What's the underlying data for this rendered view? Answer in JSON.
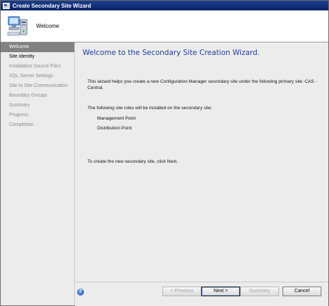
{
  "window": {
    "title": "Create Secondary Site Wizard"
  },
  "header": {
    "title": "Welcome"
  },
  "sidebar": {
    "items": [
      {
        "label": "Welcome"
      },
      {
        "label": "Site Identity"
      },
      {
        "label": "Installation Source Files"
      },
      {
        "label": "SQL Server Settings"
      },
      {
        "label": "Site to Site Communication"
      },
      {
        "label": "Boundary Groups"
      },
      {
        "label": "Summary"
      },
      {
        "label": "Progress"
      },
      {
        "label": "Completion"
      }
    ]
  },
  "main": {
    "heading": "Welcome to the Secondary Site Creation Wizard.",
    "intro": "This wizard helps you create a new Configuration Manager secondary site under the following primary site: CAS - Central.",
    "roles_intro": "The following site roles will be installed on the secondary site:",
    "roles": [
      "Management Point",
      "Distribution Point"
    ],
    "instruction": "To create the new secondary site, click Next."
  },
  "buttons": {
    "previous": "< Previous",
    "next": "Next >",
    "summary": "Summary",
    "cancel": "Cancel",
    "help": "?"
  },
  "colors": {
    "titlebar": "#0a246a",
    "active_nav": "#818181",
    "heading": "#1c3f94",
    "panel": "#ececec"
  },
  "icons": {
    "title": "wizard-window-icon",
    "header": "computer-site-icon",
    "help": "help-icon"
  }
}
